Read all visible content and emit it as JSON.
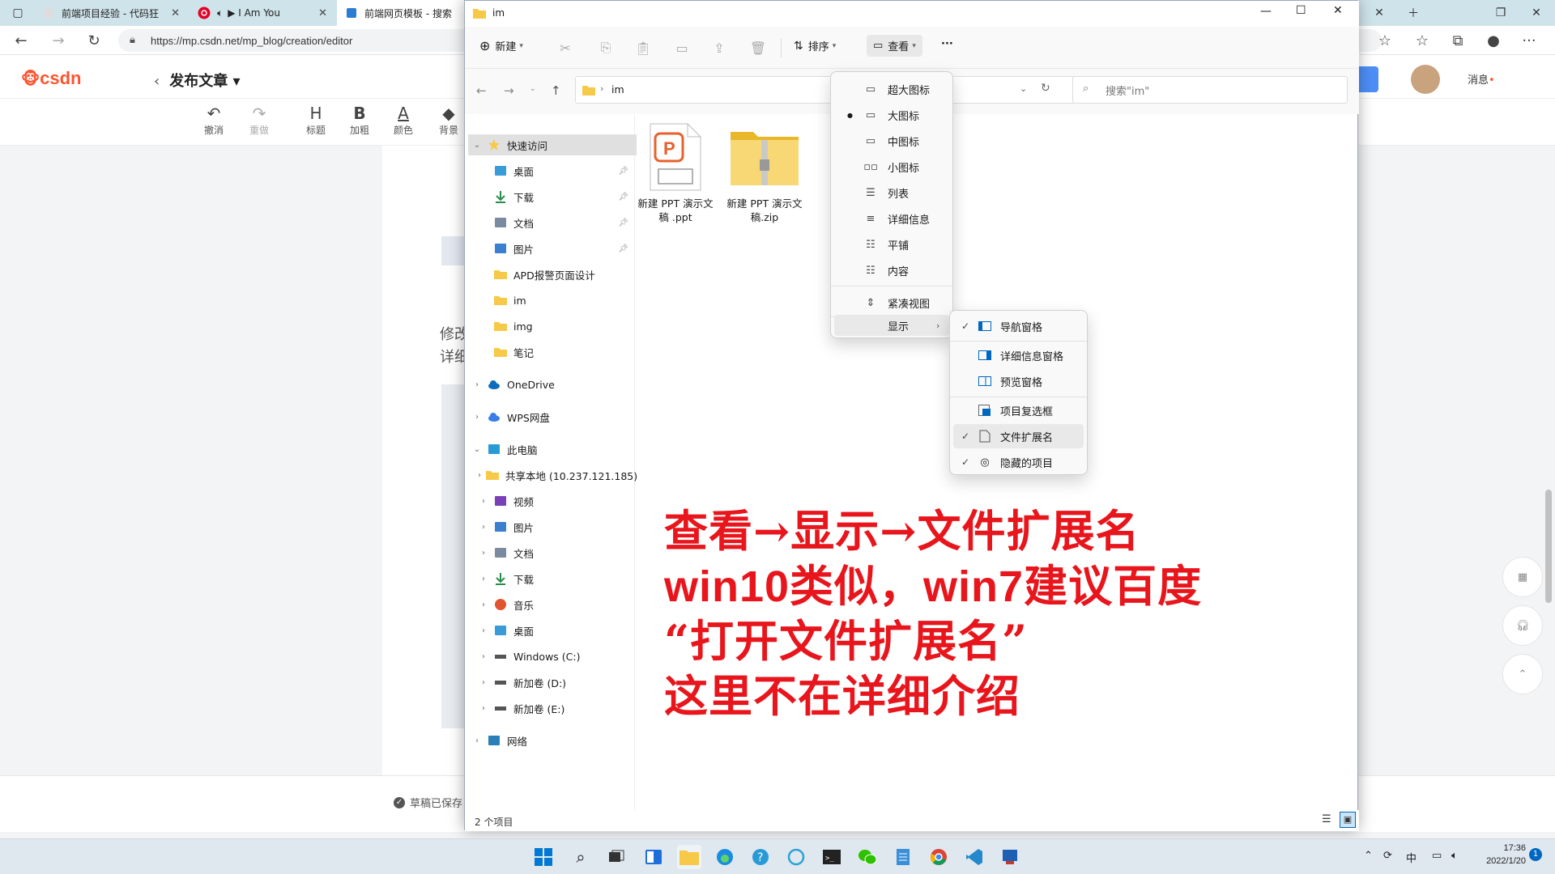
{
  "browser": {
    "tabs": [
      {
        "title": "前端项目经验 - 代码狂"
      },
      {
        "title": "▶ I Am You"
      },
      {
        "title": "前端网页模板 - 搜索"
      }
    ],
    "url": "https://mp.csdn.net/mp_blog/creation/editor"
  },
  "csdn": {
    "logo": "csdn",
    "page_title": "发布文章",
    "toolbar": [
      {
        "glyph": "↶",
        "label": "撤消"
      },
      {
        "glyph": "↷",
        "label": "重做"
      },
      {
        "glyph": "H",
        "label": "标题"
      },
      {
        "glyph": "B",
        "label": "加粗"
      },
      {
        "glyph": "A",
        "label": "颜色"
      },
      {
        "glyph": "◆",
        "label": "背景"
      }
    ],
    "doc_text_1": "修改",
    "doc_text_2": "详细",
    "draft_status": "草稿已保存",
    "messages_label": "消息"
  },
  "explorer": {
    "title": "im",
    "commands": {
      "new": "新建",
      "sort": "排序",
      "view": "查看",
      "more": "···"
    },
    "path": [
      "im"
    ],
    "search_placeholder": "搜索\"im\"",
    "sidebar": [
      {
        "label": "快速访问",
        "icon": "star-icon",
        "level": 0,
        "expanded": true,
        "selected": true
      },
      {
        "label": "桌面",
        "icon": "desktop-icon",
        "level": 1,
        "pinned": true
      },
      {
        "label": "下载",
        "icon": "download-icon",
        "level": 1,
        "pinned": true
      },
      {
        "label": "文档",
        "icon": "document-icon",
        "level": 1,
        "pinned": true
      },
      {
        "label": "图片",
        "icon": "picture-icon",
        "level": 1,
        "pinned": true
      },
      {
        "label": "APD报警页面设计",
        "icon": "folder-icon",
        "level": 1
      },
      {
        "label": "im",
        "icon": "folder-icon",
        "level": 1
      },
      {
        "label": "img",
        "icon": "folder-icon",
        "level": 1
      },
      {
        "label": "笔记",
        "icon": "folder-icon",
        "level": 1
      },
      {
        "label": "OneDrive",
        "icon": "cloud-icon",
        "level": 0
      },
      {
        "label": "WPS网盘",
        "icon": "wps-cloud-icon",
        "level": 0
      },
      {
        "label": "此电脑",
        "icon": "computer-icon",
        "level": 0,
        "expanded": true
      },
      {
        "label": "共享本地 (10.237.121.185)",
        "icon": "network-folder-icon",
        "level": 1
      },
      {
        "label": "视频",
        "icon": "video-icon",
        "level": 1
      },
      {
        "label": "图片",
        "icon": "picture-icon",
        "level": 1
      },
      {
        "label": "文档",
        "icon": "document-icon",
        "level": 1
      },
      {
        "label": "下载",
        "icon": "download-icon",
        "level": 1
      },
      {
        "label": "音乐",
        "icon": "music-icon",
        "level": 1
      },
      {
        "label": "桌面",
        "icon": "desktop-icon",
        "level": 1
      },
      {
        "label": "Windows (C:)",
        "icon": "drive-icon",
        "level": 1
      },
      {
        "label": "新加卷 (D:)",
        "icon": "drive-icon",
        "level": 1
      },
      {
        "label": "新加卷 (E:)",
        "icon": "drive-icon",
        "level": 1
      },
      {
        "label": "网络",
        "icon": "network-icon",
        "level": 0
      }
    ],
    "files": [
      {
        "name": "新建 PPT 演示文稿 .ppt",
        "icon": "ppt-file-icon"
      },
      {
        "name": "新建 PPT 演示文稿.zip",
        "icon": "zip-folder-icon"
      }
    ],
    "status": "2 个项目"
  },
  "view_menu": {
    "items": [
      {
        "label": "超大图标"
      },
      {
        "label": "大图标",
        "selected": true
      },
      {
        "label": "中图标"
      },
      {
        "label": "小图标"
      },
      {
        "label": "列表"
      },
      {
        "label": "详细信息"
      },
      {
        "label": "平铺"
      },
      {
        "label": "内容"
      }
    ],
    "compact": "紧凑视图",
    "show": "显示"
  },
  "show_menu": {
    "items": [
      {
        "label": "导航窗格",
        "checked": true
      },
      {
        "label": "详细信息窗格",
        "checked": false
      },
      {
        "label": "预览窗格",
        "checked": false
      },
      {
        "label": "项目复选框",
        "checked": false
      },
      {
        "label": "文件扩展名",
        "checked": true
      },
      {
        "label": "隐藏的项目",
        "checked": true
      }
    ]
  },
  "annotation": {
    "line1": "查看→显示→文件扩展名",
    "line2": "win10类似，win7建议百度",
    "line3": "“打开文件扩展名”",
    "line4": "这里不在详细介绍"
  },
  "taskbar": {
    "ime": "中",
    "time": "17:36",
    "date": "2022/1/20",
    "notifications": "1"
  },
  "colors": {
    "annotation": "#e8161c",
    "csdn_brand": "#fc5531",
    "accent": "#0067c0"
  }
}
